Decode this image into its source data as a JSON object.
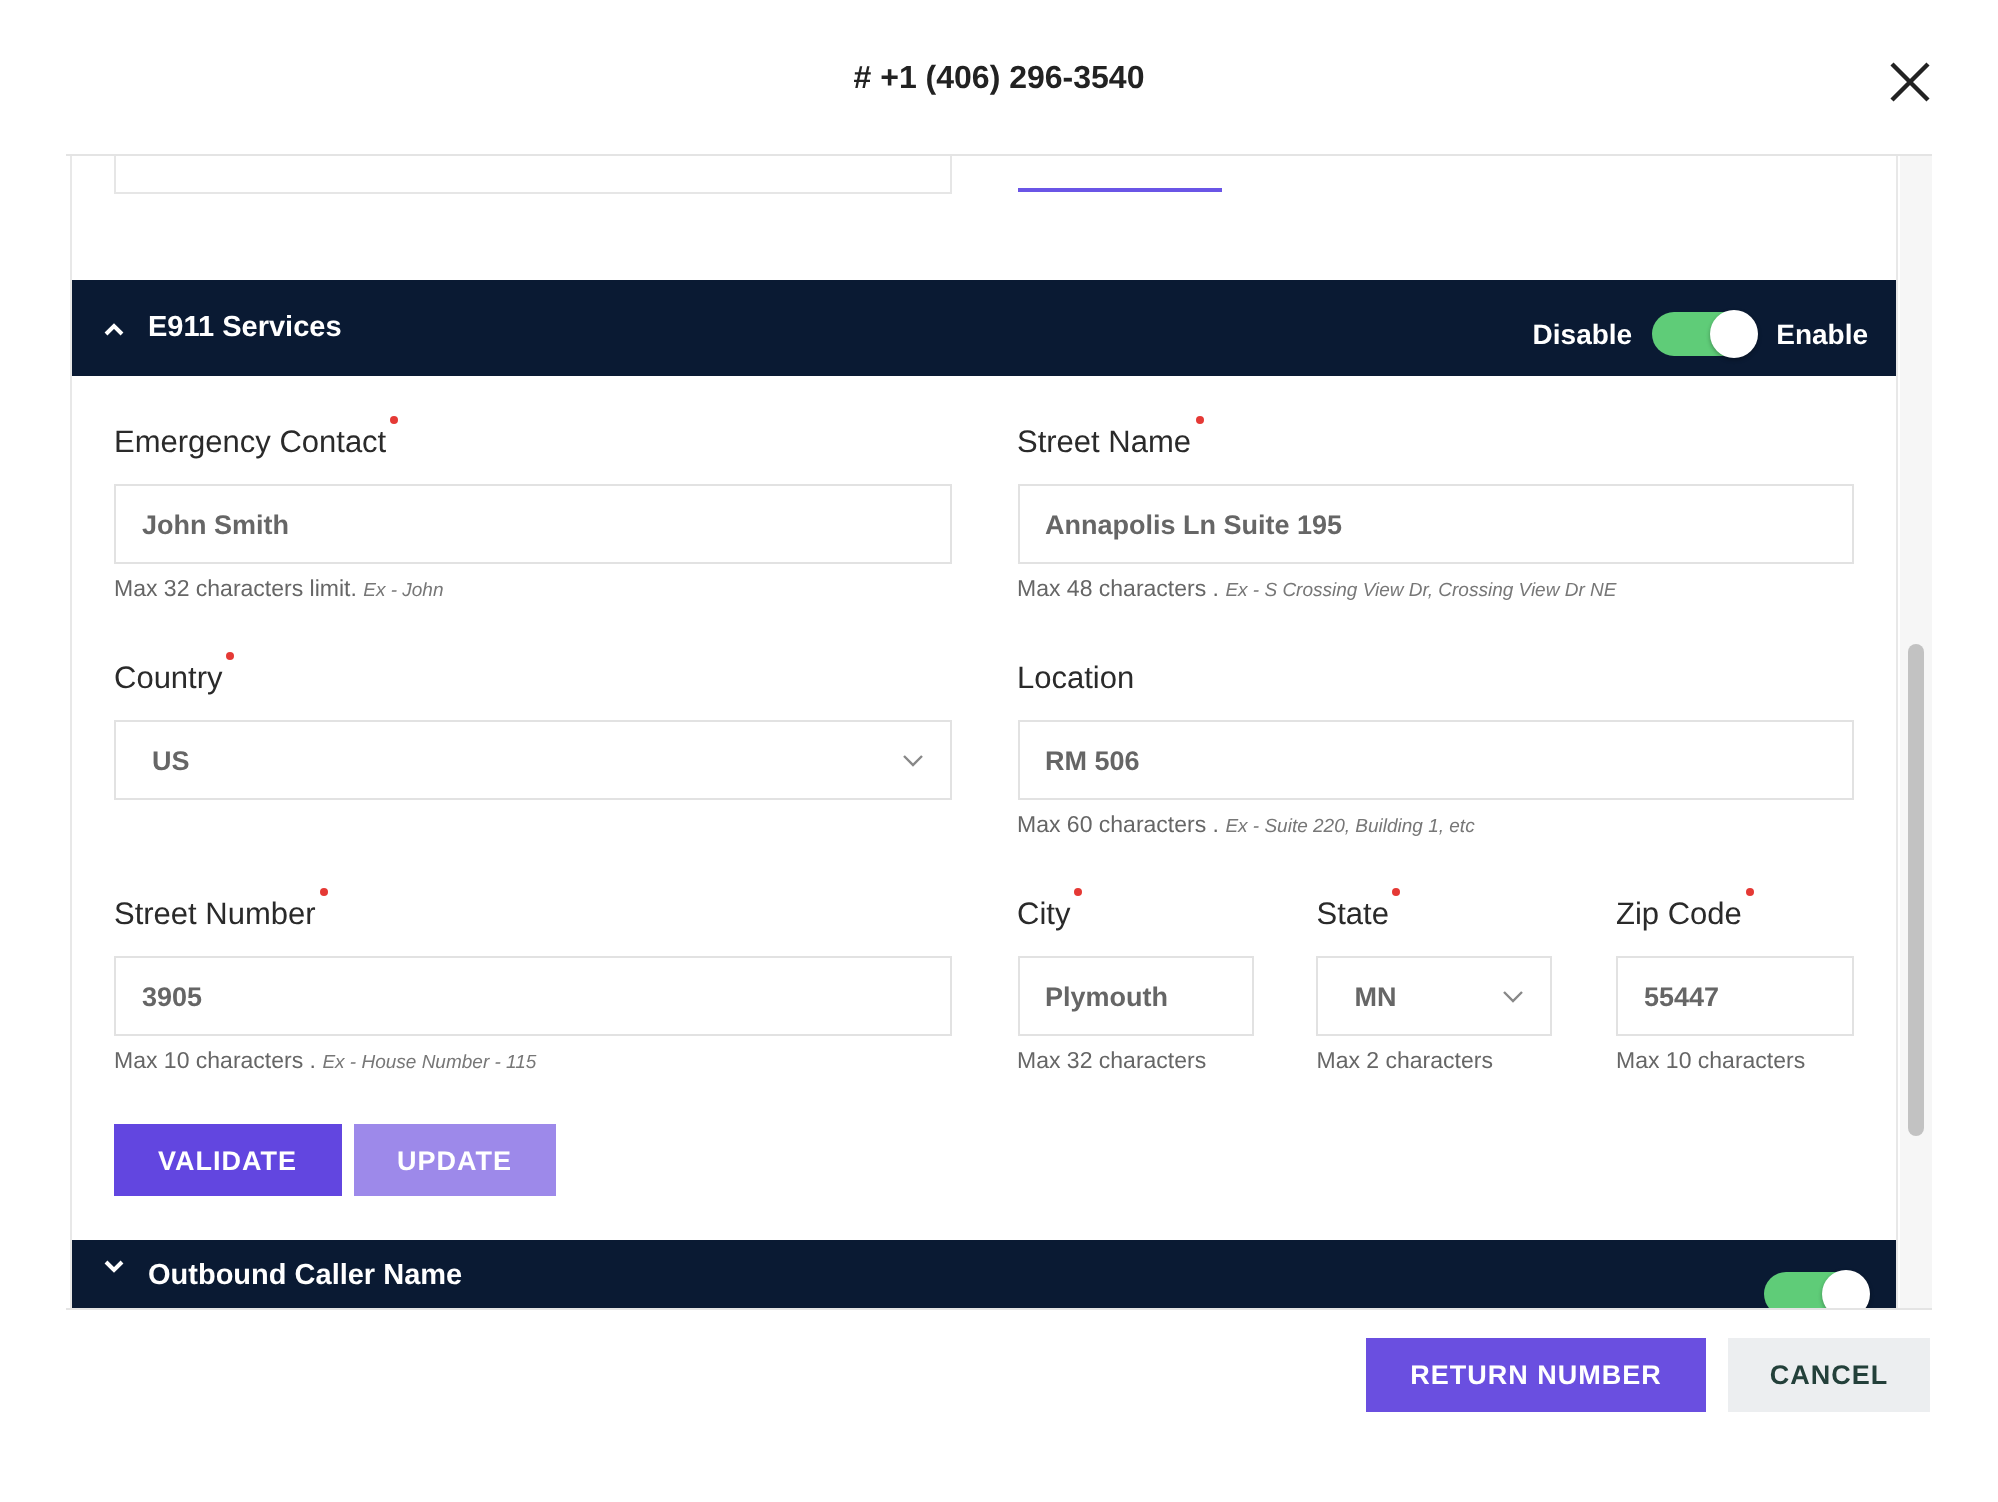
{
  "dialog": {
    "title": "# +1 (406) 296-3540"
  },
  "sections": [
    {
      "title": "E911 Services",
      "expanded": true,
      "toggle": {
        "off_label": "Disable",
        "on_label": "Enable",
        "on": true
      },
      "rows": [
        {
          "left": [
            {
              "kind": "text",
              "label": "Emergency Contact",
              "required": true,
              "value": "John Smith",
              "hint": "Max 32 characters limit.",
              "example": "Ex - John"
            }
          ],
          "right": [
            {
              "kind": "text",
              "label": "Street Name",
              "required": true,
              "value": "Annapolis Ln Suite 195",
              "hint": "Max 48 characters .",
              "example": "Ex - S Crossing View Dr, Crossing View Dr NE"
            }
          ]
        },
        {
          "left": [
            {
              "kind": "select",
              "label": "Country",
              "required": true,
              "value": "US"
            }
          ],
          "right": [
            {
              "kind": "text",
              "label": "Location",
              "required": false,
              "value": "RM 506",
              "hint": "Max 60 characters .",
              "example": "Ex - Suite 220, Building 1, etc"
            }
          ]
        },
        {
          "left": [
            {
              "kind": "text",
              "label": "Street Number",
              "required": true,
              "value": "3905",
              "hint": "Max 10 characters .",
              "example": "Ex - House Number - 115"
            }
          ],
          "right": [
            {
              "kind": "text",
              "label": "City",
              "required": true,
              "value": "Plymouth",
              "hint": "Max 32 characters"
            },
            {
              "kind": "select",
              "label": "State",
              "required": true,
              "value": "MN",
              "hint": "Max 2 characters"
            },
            {
              "kind": "text",
              "label": "Zip Code",
              "required": true,
              "value": "55447",
              "hint": "Max 10 characters"
            }
          ]
        }
      ],
      "buttons": [
        {
          "label": "VALIDATE",
          "disabled": false
        },
        {
          "label": "UPDATE",
          "disabled": true
        }
      ]
    },
    {
      "title": "Outbound Caller Name",
      "expanded": false,
      "toggle": {
        "on": true
      }
    }
  ],
  "footer_buttons": [
    {
      "label": "RETURN NUMBER",
      "kind": "primary"
    },
    {
      "label": "CANCEL",
      "kind": "secondary"
    }
  ]
}
